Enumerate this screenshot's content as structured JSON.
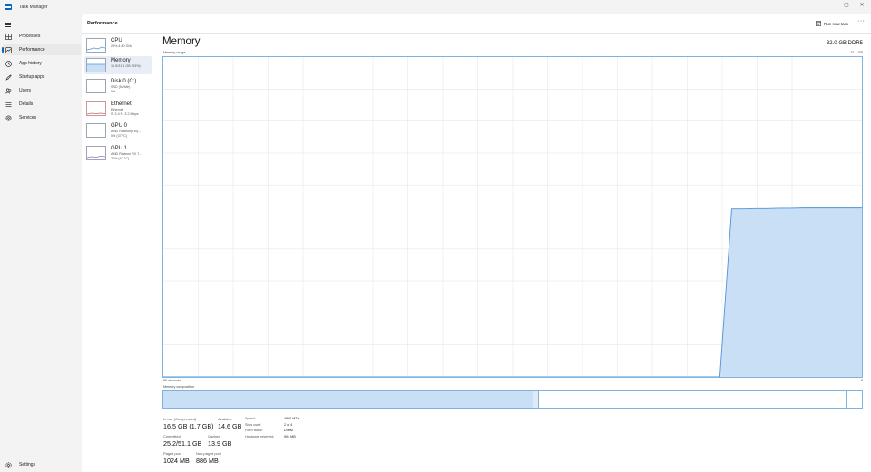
{
  "window": {
    "title": "Task Manager",
    "controls": {
      "minimize": "—",
      "maximize": "▢",
      "close": "✕"
    }
  },
  "nav": {
    "items": [
      {
        "label": "Processes",
        "icon": "grid-icon"
      },
      {
        "label": "Performance",
        "icon": "gauge-icon",
        "active": true
      },
      {
        "label": "App history",
        "icon": "history-icon"
      },
      {
        "label": "Startup apps",
        "icon": "rocket-icon"
      },
      {
        "label": "Users",
        "icon": "users-icon"
      },
      {
        "label": "Details",
        "icon": "list-icon"
      },
      {
        "label": "Services",
        "icon": "services-icon"
      }
    ],
    "settings": {
      "label": "Settings",
      "icon": "gear-icon"
    }
  },
  "header": {
    "title": "Performance",
    "run_new_task": "Run new task",
    "more": "···"
  },
  "devices": [
    {
      "name": "CPU",
      "sub1": "25% 4.50 GHz",
      "sub2": ""
    },
    {
      "name": "Memory",
      "sub1": "16.5/31.1 GB (53%)",
      "sub2": "",
      "active": true
    },
    {
      "name": "Disk 0 (C:)",
      "sub1": "SSD (NVMe)",
      "sub2": "0%"
    },
    {
      "name": "Ethernet",
      "sub1": "Ethernet",
      "sub2": "S: 2.4 R: 3.2 Mbps"
    },
    {
      "name": "GPU 0",
      "sub1": "AMD Radeon(TM)...",
      "sub2": "0% (37 °C)"
    },
    {
      "name": "GPU 1",
      "sub1": "AMD Radeon RX 7...",
      "sub2": "22% (47 °C)"
    }
  ],
  "memory": {
    "title": "Memory",
    "total": "32.0 GB DDR5",
    "usage_label": "Memory usage",
    "max_label": "31.1 GB",
    "time_left": "60 seconds",
    "time_right": "0",
    "composition_label": "Memory composition",
    "usage_series_fraction": [
      0,
      0,
      0,
      0,
      0,
      0,
      0,
      0,
      0,
      0,
      0,
      0,
      0,
      0,
      0,
      0,
      0,
      0,
      0,
      0,
      0,
      0,
      0,
      0,
      0,
      0,
      0,
      0,
      0,
      0,
      0,
      0,
      0,
      0,
      0,
      0,
      0,
      0,
      0,
      0,
      0,
      0,
      0,
      0,
      0,
      0,
      0,
      0,
      0.525,
      0.525,
      0.526,
      0.526,
      0.527,
      0.527,
      0.528,
      0.528,
      0.528,
      0.528,
      0.528,
      0.528
    ],
    "composition_in_use_fraction": 0.53,
    "composition_modified_fraction": 0.008,
    "composition_standby_fraction": 0.44,
    "stats": {
      "in_use_label": "In use (Compressed)",
      "in_use_value": "16.5 GB (1.7 GB)",
      "available_label": "Available",
      "available_value": "14.6 GB",
      "committed_label": "Committed",
      "committed_value": "25.2/51.1 GB",
      "cached_label": "Cached",
      "cached_value": "13.9 GB",
      "paged_label": "Paged pool",
      "paged_value": "1024 MB",
      "nonpaged_label": "Non-paged pool",
      "nonpaged_value": "886 MB"
    },
    "details": [
      {
        "key": "Speed:",
        "value": "4800 MT/s"
      },
      {
        "key": "Slots used:",
        "value": "2 of 4"
      },
      {
        "key": "Form factor:",
        "value": "DIMM"
      },
      {
        "key": "Hardware reserved:",
        "value": "904 MB"
      }
    ]
  },
  "colors": {
    "accent": "#0067c0",
    "graph_fill": "#c9dff6",
    "graph_line": "#4f94d4",
    "graph_grid": "#e3e8ee"
  }
}
